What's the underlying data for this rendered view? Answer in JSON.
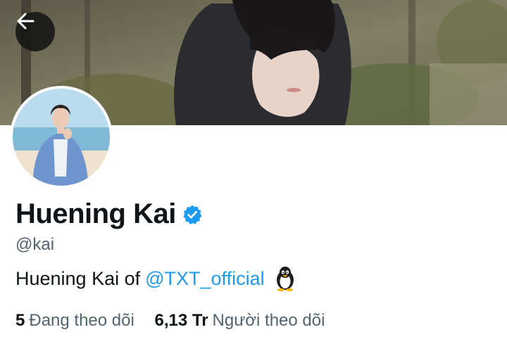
{
  "profile": {
    "display_name": "Huening Kai",
    "handle": "@kai",
    "verified": true,
    "bio_prefix": "Huening Kai of",
    "bio_mention": "@TXT_official",
    "bio_emoji": "penguin-emoji"
  },
  "stats": {
    "following_count": "5",
    "following_label": "Đang theo dõi",
    "followers_count": "6,13 Tr",
    "followers_label": "Người theo dõi"
  },
  "icons": {
    "back": "arrow-left-icon",
    "verified": "verified-badge-icon"
  },
  "colors": {
    "accent": "#1d9bf0",
    "text_primary": "#0f1419",
    "text_secondary": "#536471"
  }
}
